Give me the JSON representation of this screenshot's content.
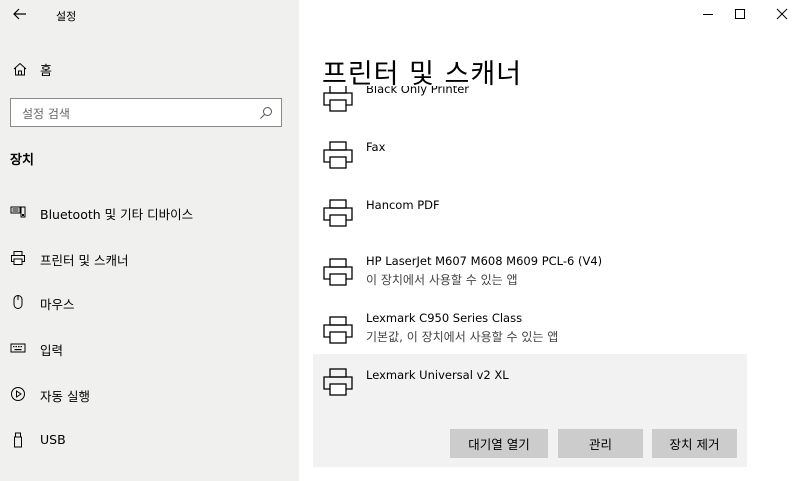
{
  "window": {
    "title": "설정",
    "controls": {
      "minimize": "–",
      "maximize": "☐",
      "close": "✕"
    }
  },
  "sidebar": {
    "home_label": "홈",
    "search_placeholder": "설정 검색",
    "section_title": "장치",
    "items": [
      {
        "label": "Bluetooth 및 기타 디바이스",
        "icon": "bluetooth-devices-icon"
      },
      {
        "label": "프린터 및 스캐너",
        "icon": "printer-icon"
      },
      {
        "label": "마우스",
        "icon": "mouse-icon"
      },
      {
        "label": "입력",
        "icon": "keyboard-icon"
      },
      {
        "label": "자동 실행",
        "icon": "autoplay-icon"
      },
      {
        "label": "USB",
        "icon": "usb-icon"
      }
    ]
  },
  "main": {
    "title": "프린터 및 스캐너",
    "devices": [
      {
        "name": "Black Only Printer",
        "subtitle": ""
      },
      {
        "name": "Fax",
        "subtitle": ""
      },
      {
        "name": "Hancom PDF",
        "subtitle": ""
      },
      {
        "name": "HP LaserJet M607 M608 M609 PCL-6 (V4)",
        "subtitle": "이 장치에서 사용할 수 있는 앱"
      },
      {
        "name": "Lexmark C950 Series Class",
        "subtitle": "기본값, 이 장치에서 사용할 수 있는 앱"
      },
      {
        "name": "Lexmark Universal v2 XL",
        "subtitle": ""
      }
    ],
    "actions": {
      "open_queue": "대기열 열기",
      "manage": "관리",
      "remove": "장치 제거"
    }
  },
  "colors": {
    "sidebar_bg": "#f0f0ef",
    "selected_bg": "#f2f2f2",
    "button_bg": "#cccccc"
  }
}
